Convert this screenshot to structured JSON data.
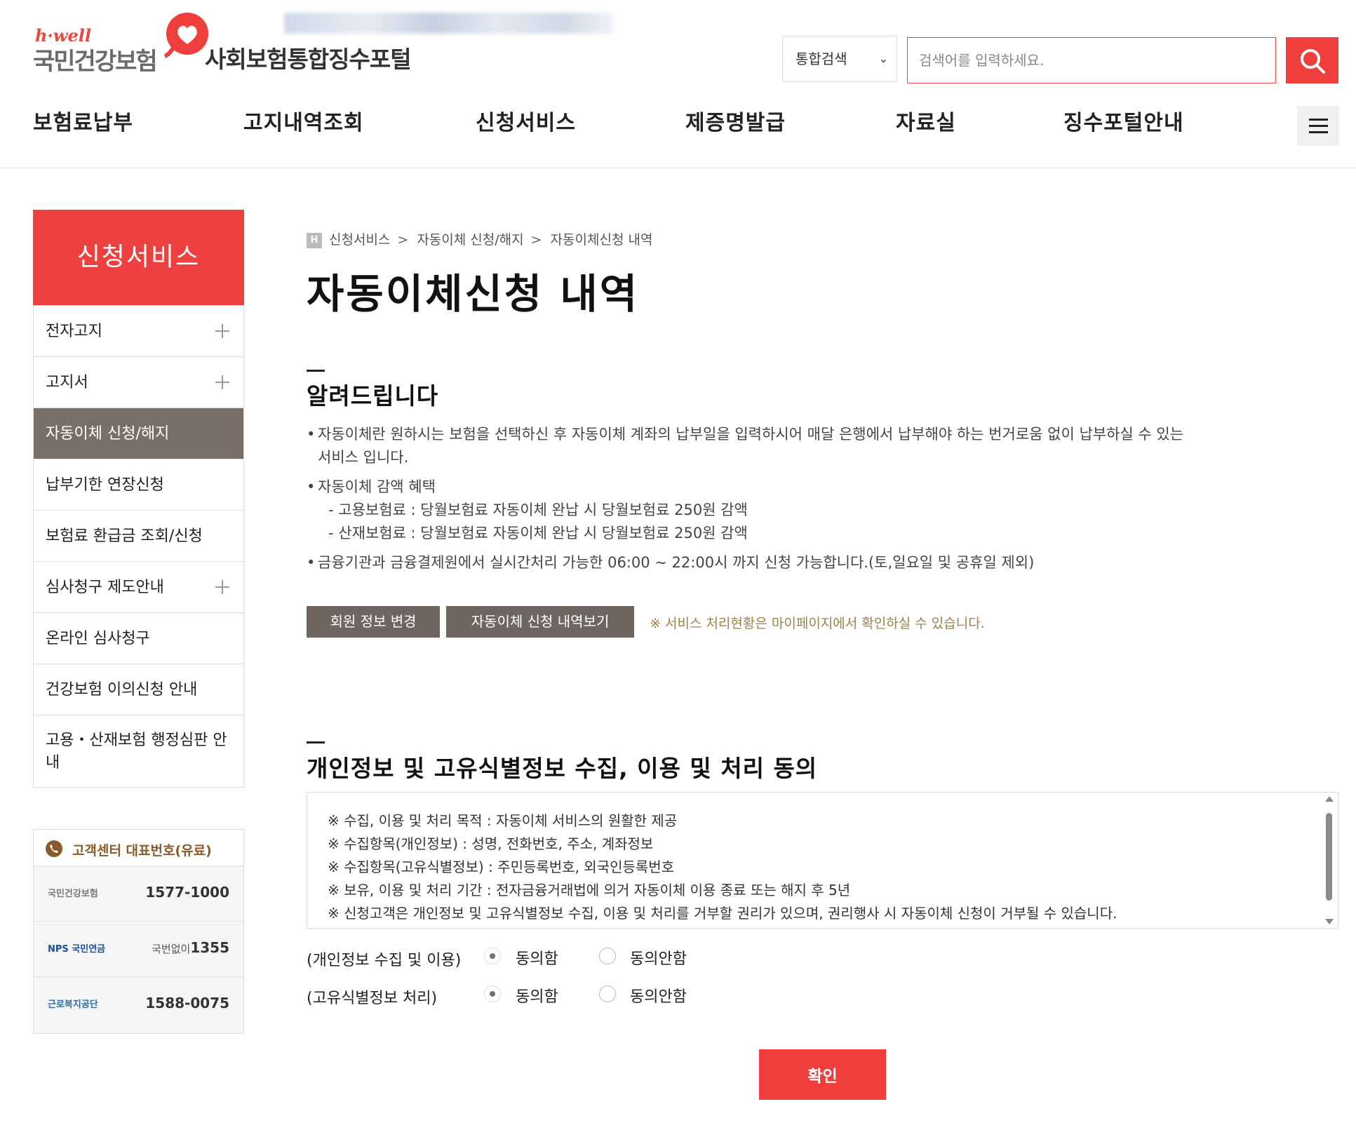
{
  "header": {
    "logo_brand": "h·well",
    "logo_name": "국민건강보험",
    "portal_title": "사회보험통합징수포털",
    "search": {
      "select_value": "통합검색",
      "placeholder": "검색어를 입력하세요."
    },
    "gnb": [
      "보험료납부",
      "고지내역조회",
      "신청서비스",
      "제증명발급",
      "자료실",
      "징수포털안내"
    ]
  },
  "lnb": {
    "title": "신청서비스",
    "items": [
      {
        "label": "전자고지",
        "has_sub": true
      },
      {
        "label": "고지서",
        "has_sub": true
      },
      {
        "label": "자동이체 신청/해지",
        "active": true
      },
      {
        "label": "납부기한 연장신청"
      },
      {
        "label": "보험료 환급금 조회/신청"
      },
      {
        "label": "심사청구 제도안내",
        "has_sub": true
      },
      {
        "label": "온라인 심사청구"
      },
      {
        "label": "건강보험 이의신청 안내"
      },
      {
        "label": "고용・산재보험 행정심판 안내"
      }
    ]
  },
  "customer_center": {
    "title": "고객센터 대표번호(유료)",
    "rows": [
      {
        "org": "국민건강보험",
        "number": "1577-1000",
        "prefix": ""
      },
      {
        "org": "NPS 국민연금",
        "number": "1355",
        "prefix": "국번없이"
      },
      {
        "org": "근로복지공단",
        "number": "1588-0075",
        "prefix": ""
      }
    ]
  },
  "breadcrumb": {
    "home": "H",
    "items": [
      "신청서비스",
      "자동이체 신청/해지",
      "자동이체신청 내역"
    ],
    "separator": ">"
  },
  "page_title": "자동이체신청 내역",
  "notice": {
    "title": "알려드립니다",
    "line1a": "자동이체란 원하시는 보험을 선택하신 후 자동이체 계좌의 납부일을 입력하시어 매달 은행에서 납부해야 하는 번거로움 없이 납부하실 수 있는",
    "line1b": "서비스 입니다.",
    "line2": "자동이체 감액 혜택",
    "line2_sub1": "- 고용보험료 : 당월보험료 자동이체 완납 시 당월보험료 250원 감액",
    "line2_sub2": "- 산재보험료 : 당월보험료 자동이체 완납 시 당월보험료 250원 감액",
    "line3": "금융기관과 금융결제원에서 실시간처리 가능한 06:00 ~ 22:00시 까지 신청 가능합니다.(토,일요일 및 공휴일 제외)"
  },
  "buttons": {
    "member_info": "회원 정보 변경",
    "view_history": "자동이체 신청 내역보기",
    "note": "※ 서비스 처리현황은 마이페이지에서 확인하실 수 있습니다.",
    "confirm": "확인"
  },
  "consent": {
    "title": "개인정보 및 고유식별정보 수집, 이용 및 처리 동의",
    "terms": [
      "※ 수집, 이용 및 처리 목적 : 자동이체 서비스의 원활한 제공",
      "※ 수집항목(개인정보) : 성명, 전화번호, 주소, 계좌정보",
      "※ 수집항목(고유식별정보) : 주민등록번호, 외국인등록번호",
      "※ 보유, 이용 및 처리 기간 : 전자금융거래법에 의거 자동이체 이용 종료 또는 해지 후 5년",
      "※ 신청고객은 개인정보 및 고유식별정보 수집, 이용 및 처리를 거부할 권리가 있으며, 권리행사 시 자동이체 신청이 거부될 수 있습니다."
    ],
    "rows": [
      {
        "label": "(개인정보 수집 및 이용)",
        "agree": "동의함",
        "disagree": "동의안함",
        "selected": "agree"
      },
      {
        "label": "(고유식별정보 처리)",
        "agree": "동의함",
        "disagree": "동의안함",
        "selected": "agree"
      }
    ]
  },
  "colors": {
    "brand_red": "#ef3e3b",
    "lnb_active": "#7a6e69",
    "button_gray": "#6f6661",
    "note_brown": "#a0804a"
  }
}
